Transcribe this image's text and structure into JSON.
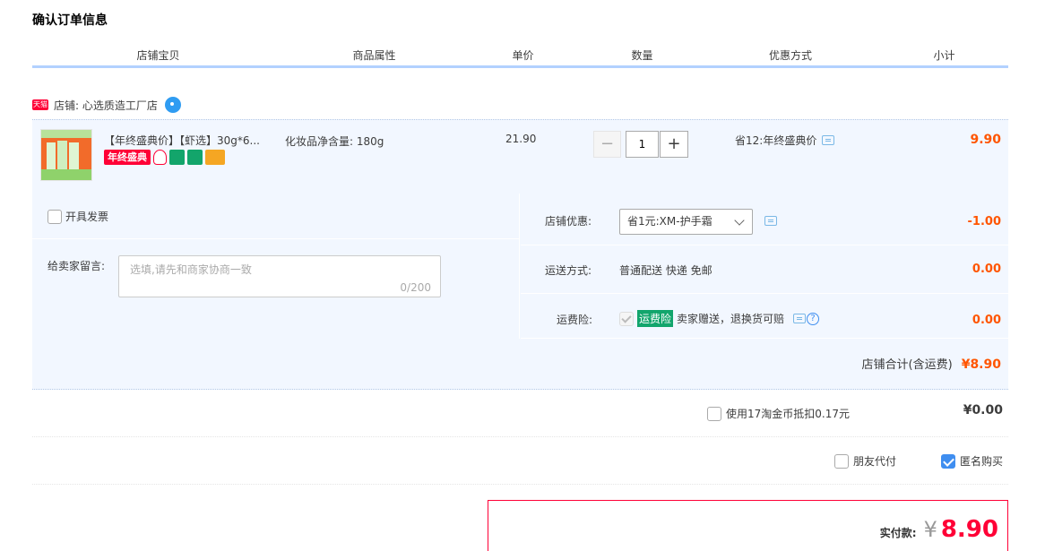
{
  "page": {
    "title": "确认订单信息"
  },
  "table_headers": [
    "店铺宝贝",
    "商品属性",
    "单价",
    "数量",
    "优惠方式",
    "小计"
  ],
  "shop": {
    "badge": "天猫",
    "label": "店铺: 心选质造工厂店"
  },
  "item": {
    "name": "【年终盛典价】【虾选】30g*6...",
    "sale_badge": "年终盛典",
    "property": "化妆品净含量: 180g",
    "unit_price": "21.90",
    "minus": "−",
    "quantity": "1",
    "plus": "+",
    "promotion": "省12:年终盛典价",
    "subtotal": "9.90"
  },
  "options": {
    "invoice_label": "开具发票",
    "message_label": "给卖家留言:",
    "message_placeholder": "选填,请先和商家协商一致",
    "message_count": "0/200"
  },
  "shop_discount": {
    "label": "店铺优惠:",
    "selected": "省1元:XM-护手霜",
    "value": "-1.00"
  },
  "shipping": {
    "label": "运送方式:",
    "method": "普通配送 快递 免邮",
    "value": "0.00"
  },
  "insurance": {
    "label": "运费险:",
    "tag": "运费险",
    "desc": "卖家赠送，退换货可赔",
    "help": "?",
    "value": "0.00"
  },
  "shop_total": {
    "label": "店铺合计(含运费)",
    "value": "¥8.90"
  },
  "coins": {
    "label": "使用17淘金币抵扣0.17元",
    "value": "¥0.00"
  },
  "extra": {
    "friend_pay": "朋友代付",
    "anonymous": "匿名购买"
  },
  "payment": {
    "label": "实付款:",
    "currency": "¥",
    "amount": "8.90"
  },
  "colors": {
    "accent_red": "#ff0036",
    "price_orange": "#ff5500",
    "header_blue": "#b2d1ff",
    "panel_bg": "#f2f7ff"
  }
}
